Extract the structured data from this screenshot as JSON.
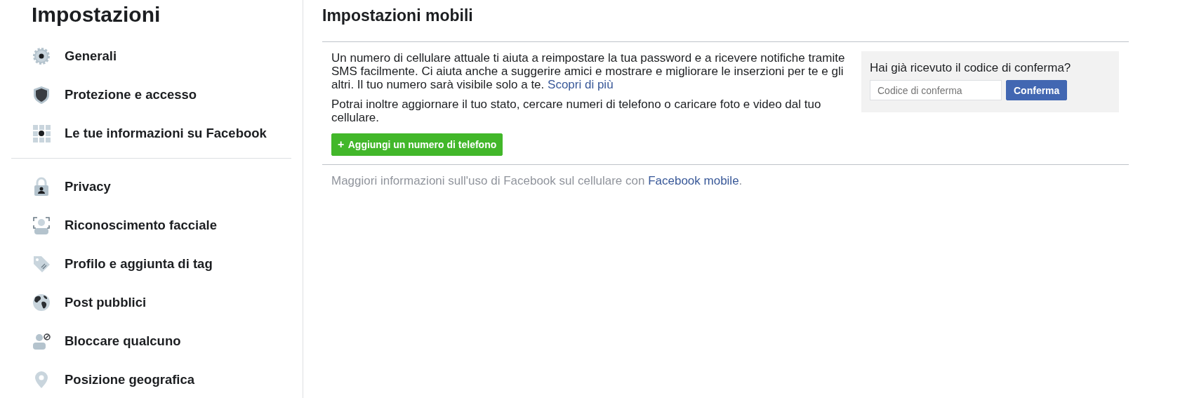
{
  "sidebar": {
    "title": "Impostazioni",
    "groups": [
      [
        {
          "label": "Generali"
        },
        {
          "label": "Protezione e accesso"
        },
        {
          "label": "Le tue informazioni su Facebook"
        }
      ],
      [
        {
          "label": "Privacy"
        },
        {
          "label": "Riconoscimento facciale"
        },
        {
          "label": "Profilo e aggiunta di tag"
        },
        {
          "label": "Post pubblici"
        },
        {
          "label": "Bloccare qualcuno"
        },
        {
          "label": "Posizione geografica"
        }
      ]
    ]
  },
  "main": {
    "title": "Impostazioni mobili",
    "paragraphs": [
      {
        "text": "Un numero di cellulare attuale ti aiuta a reimpostare la tua password e a ricevere notifiche tramite SMS facilmente. Ci aiuta anche a suggerire amici e mostrare e migliorare le inserzioni per te e gli altri. Il tuo numero sarà visibile solo a te.",
        "link": "Scopri di più"
      },
      {
        "text": "Potrai inoltre aggiornare il tuo stato, cercare numeri di telefono o caricare foto e video dal tuo cellulare."
      }
    ],
    "add_button": {
      "icon": "+",
      "label": "Aggiungi un numero di telefono"
    },
    "confirm_box": {
      "question": "Hai già ricevuto il codice di conferma?",
      "placeholder": "Codice di conferma",
      "button": "Conferma"
    },
    "footer": {
      "text": "Maggiori informazioni sull'uso di Facebook sul cellulare con",
      "link": "Facebook mobile",
      "after": "."
    }
  }
}
